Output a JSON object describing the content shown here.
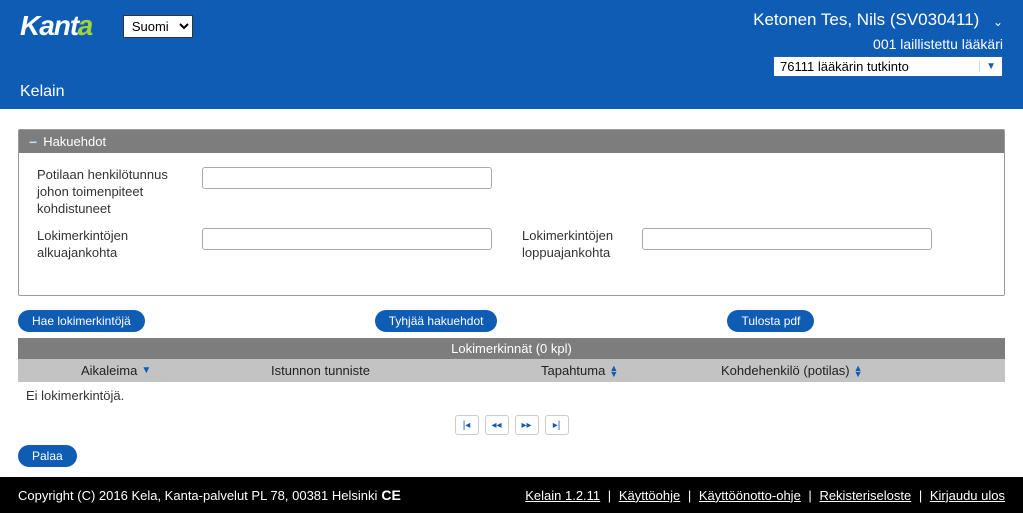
{
  "header": {
    "logo_prefix": "Kant",
    "logo_accent": "a",
    "subtitle": "Kelain",
    "language_selected": "Suomi",
    "user_name": "Ketonen Tes, Nils (SV030411)",
    "user_role": "001 laillistettu lääkäri",
    "qualification_selected": "76111 lääkärin tutkinto"
  },
  "panel": {
    "title": "Hakuehdot",
    "fields": {
      "patient_id_label": "Potilaan henkilötunnus johon toimenpiteet kohdistuneet",
      "patient_id_value": "",
      "start_label": "Lokimerkintöjen alkuajankohta",
      "start_value": "",
      "end_label": "Lokimerkintöjen loppuajankohta",
      "end_value": ""
    }
  },
  "buttons": {
    "search": "Hae lokimerkintöjä",
    "clear": "Tyhjää hakuehdot",
    "print": "Tulosta pdf",
    "back": "Palaa"
  },
  "table": {
    "title": "Lokimerkinnät (0 kpl)",
    "columns": {
      "timestamp": "Aikaleima",
      "session": "Istunnon tunniste",
      "event": "Tapahtuma",
      "target": "Kohdehenkilö (potilas)"
    },
    "empty": "Ei lokimerkintöjä."
  },
  "footer": {
    "copyright": "Copyright (C) 2016 Kela, Kanta-palvelut PL 78, 00381 Helsinki",
    "ce": "CE",
    "links": {
      "version": "Kelain 1.2.11",
      "guide": "Käyttöohje",
      "setup": "Käyttöönotto-ohje",
      "register": "Rekisteriseloste",
      "logout": "Kirjaudu ulos"
    }
  }
}
